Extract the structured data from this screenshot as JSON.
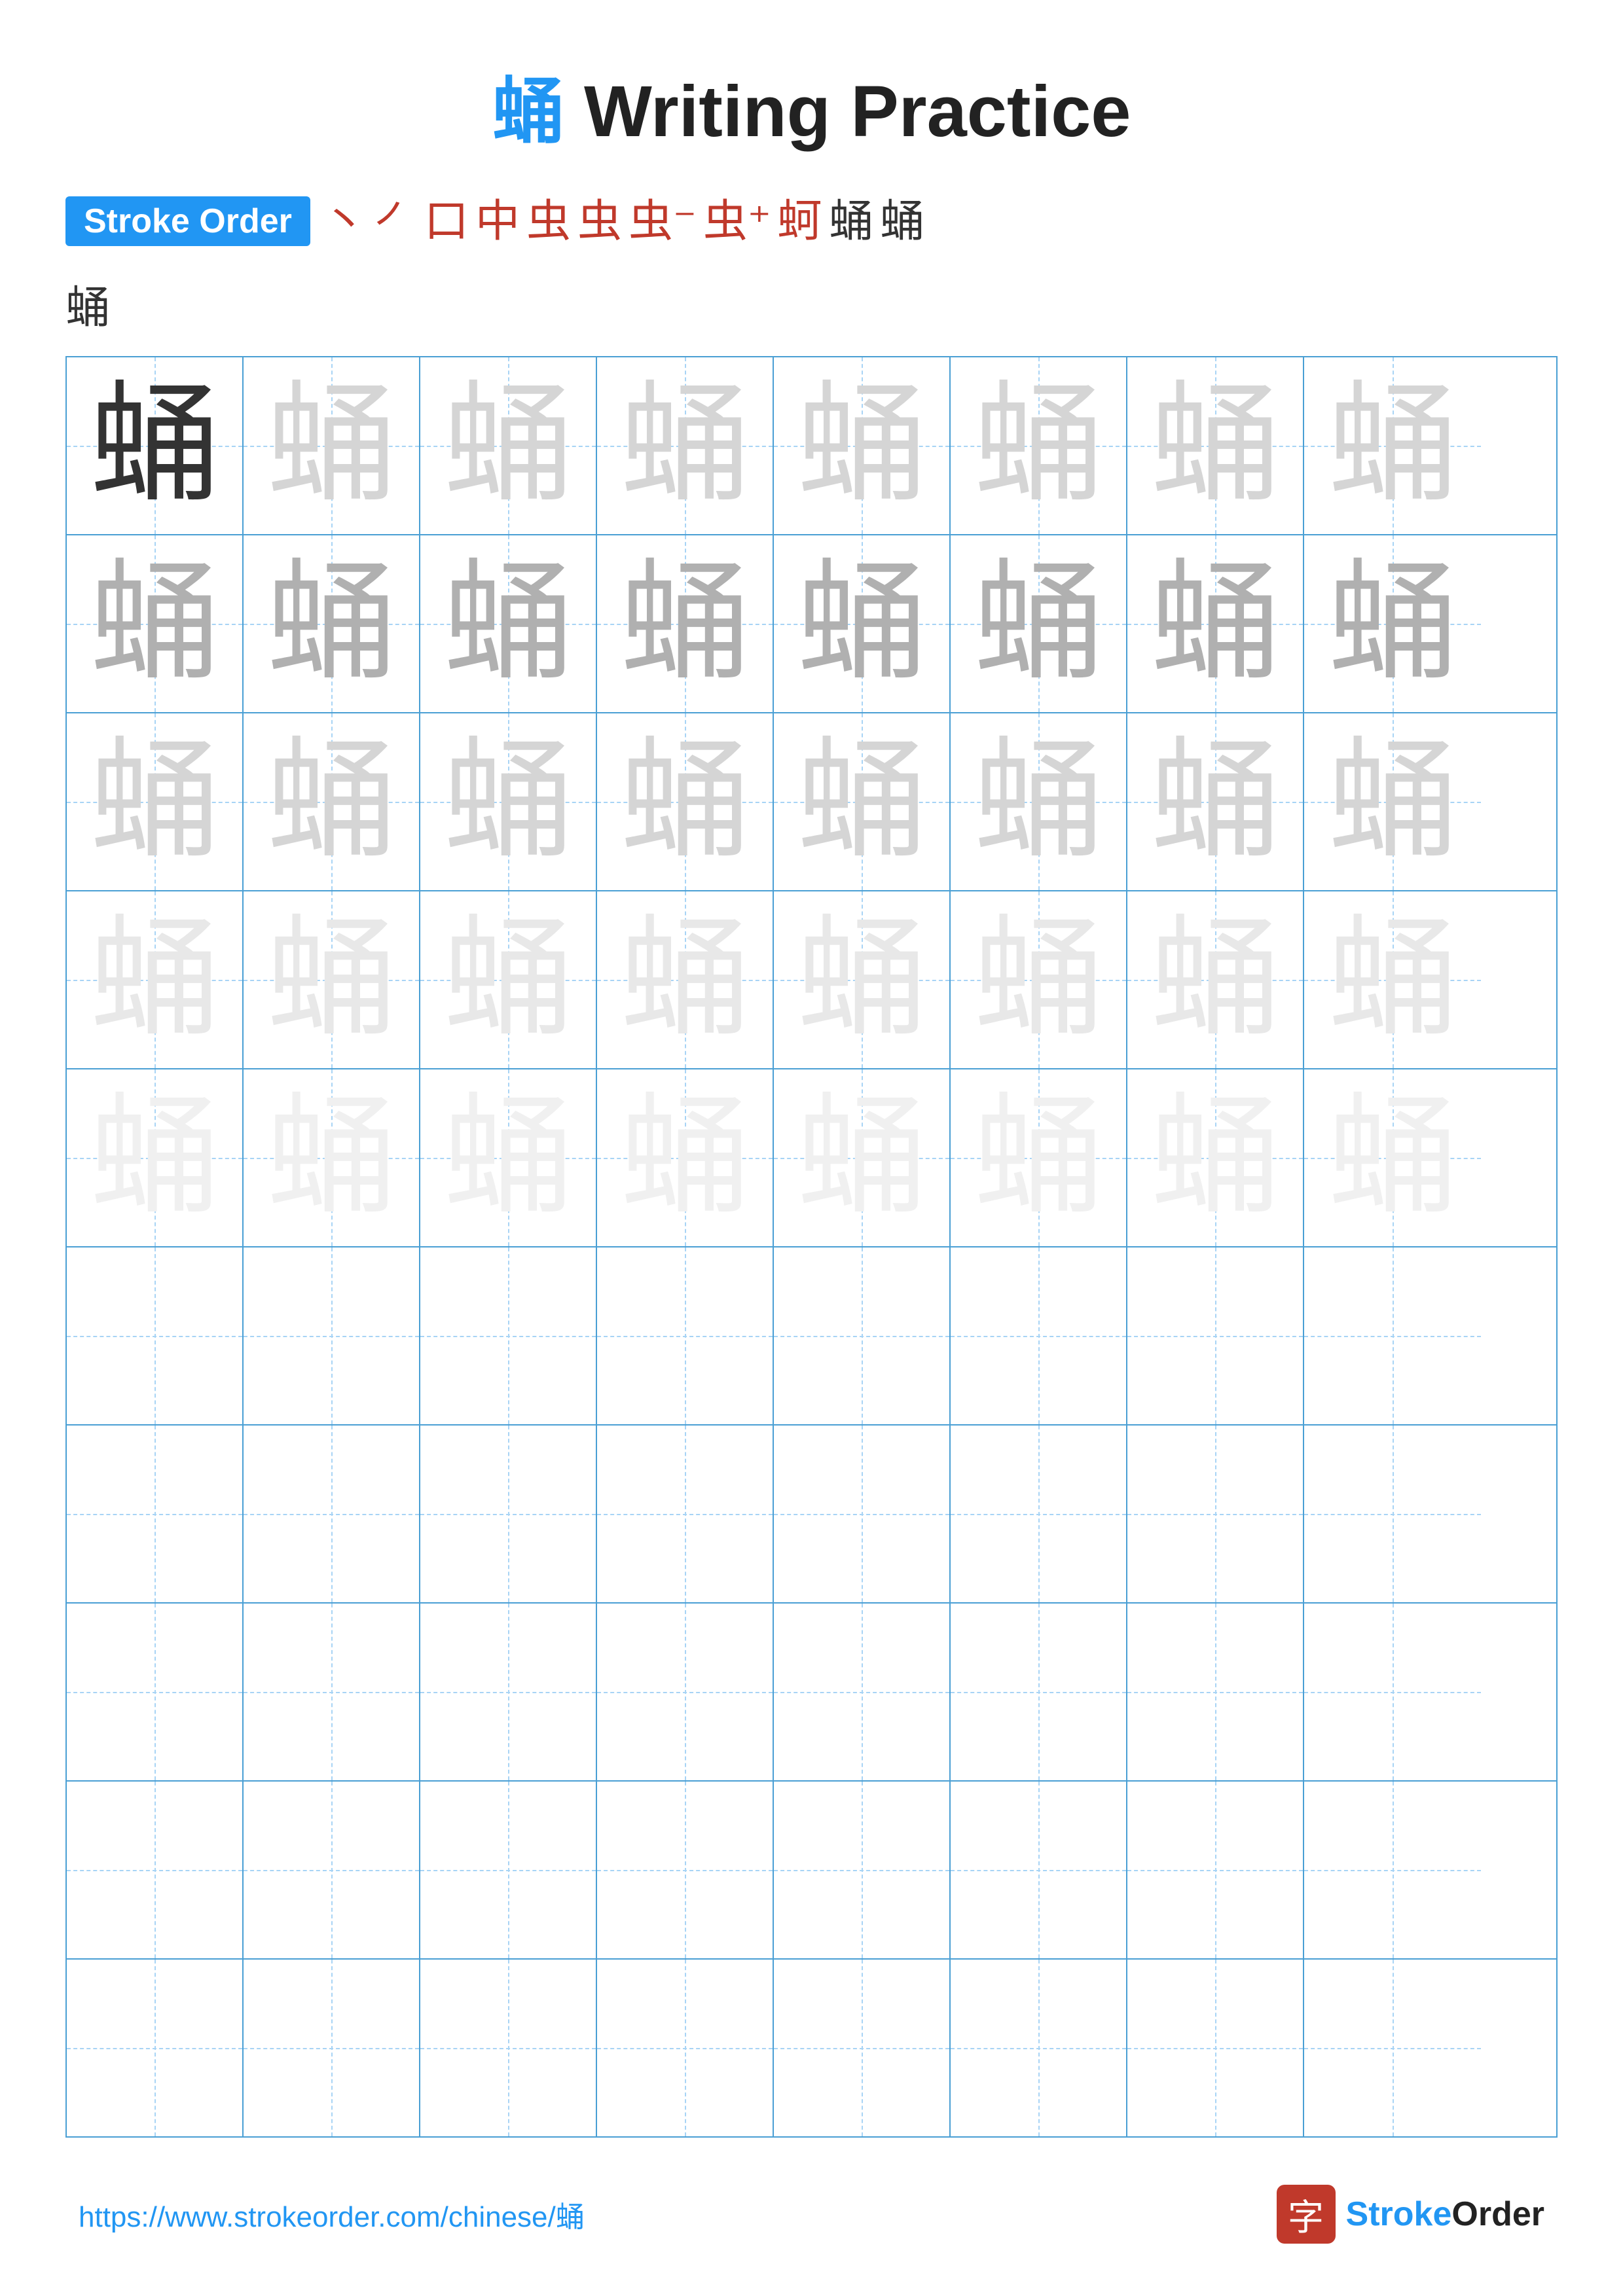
{
  "title": {
    "char": "蛹",
    "text": " Writing Practice"
  },
  "stroke_order": {
    "badge_label": "Stroke Order",
    "steps": [
      "丶",
      "㇒",
      "口",
      "中",
      "虫",
      "虫",
      "虫⁻",
      "虫⁺",
      "蚵",
      "蛹",
      "蛹"
    ],
    "last_line": "蛹"
  },
  "grid": {
    "rows": 10,
    "cols": 8,
    "char": "蛹",
    "shades": [
      [
        "dark",
        "light",
        "light",
        "light",
        "light",
        "light",
        "light",
        "light"
      ],
      [
        "med",
        "med",
        "med",
        "med",
        "med",
        "med",
        "med",
        "med"
      ],
      [
        "light",
        "light",
        "light",
        "light",
        "light",
        "light",
        "light",
        "light"
      ],
      [
        "vlight",
        "vlight",
        "vlight",
        "vlight",
        "vlight",
        "vlight",
        "vlight",
        "vlight"
      ],
      [
        "ghost",
        "ghost",
        "ghost",
        "ghost",
        "ghost",
        "ghost",
        "ghost",
        "ghost"
      ],
      [
        "empty",
        "empty",
        "empty",
        "empty",
        "empty",
        "empty",
        "empty",
        "empty"
      ],
      [
        "empty",
        "empty",
        "empty",
        "empty",
        "empty",
        "empty",
        "empty",
        "empty"
      ],
      [
        "empty",
        "empty",
        "empty",
        "empty",
        "empty",
        "empty",
        "empty",
        "empty"
      ],
      [
        "empty",
        "empty",
        "empty",
        "empty",
        "empty",
        "empty",
        "empty",
        "empty"
      ],
      [
        "empty",
        "empty",
        "empty",
        "empty",
        "empty",
        "empty",
        "empty",
        "empty"
      ]
    ]
  },
  "footer": {
    "url": "https://www.strokeorder.com/chinese/蛹",
    "logo_icon": "字",
    "logo_text_plain": "StrokeOrder",
    "logo_text_colored": "Stroke"
  }
}
